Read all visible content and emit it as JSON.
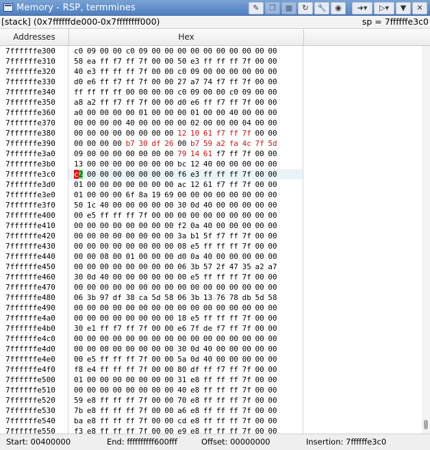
{
  "window": {
    "title": "Memory - RSP, termmines"
  },
  "toolbar": {
    "buttons": [
      "edit-icon",
      "copy-icon",
      "paste-icon",
      "refresh-icon",
      "wrench-icon",
      "camera-icon",
      "goto-icon",
      "run-icon",
      "menu-icon",
      "close-icon"
    ]
  },
  "info": {
    "region": "[stack] (0x7ffffffde000-0x7ffffffff000)",
    "sp": "sp = 7ffffffe3c0"
  },
  "columns": {
    "addresses": "Addresses",
    "hex": "Hex"
  },
  "rows": [
    {
      "addr": "7ffffffe300",
      "bytes": [
        "c0",
        "09",
        "00",
        "00",
        "c0",
        "09",
        "00",
        "00",
        "00",
        "00",
        "00",
        "00",
        "00",
        "00",
        "00",
        "00"
      ]
    },
    {
      "addr": "7ffffffe310",
      "bytes": [
        "58",
        "ea",
        "ff",
        "f7",
        "ff",
        "7f",
        "00",
        "00",
        "50",
        "e3",
        "ff",
        "ff",
        "ff",
        "7f",
        "00",
        "00"
      ]
    },
    {
      "addr": "7ffffffe320",
      "bytes": [
        "40",
        "e3",
        "ff",
        "ff",
        "ff",
        "7f",
        "00",
        "00",
        "c0",
        "09",
        "00",
        "00",
        "00",
        "00",
        "00",
        "00"
      ]
    },
    {
      "addr": "7ffffffe330",
      "bytes": [
        "d0",
        "e6",
        "ff",
        "f7",
        "ff",
        "7f",
        "00",
        "00",
        "27",
        "a7",
        "74",
        "f7",
        "ff",
        "7f",
        "00",
        "00"
      ]
    },
    {
      "addr": "7ffffffe340",
      "bytes": [
        "ff",
        "ff",
        "ff",
        "ff",
        "00",
        "00",
        "00",
        "00",
        "c0",
        "09",
        "00",
        "00",
        "c0",
        "09",
        "00",
        "00"
      ]
    },
    {
      "addr": "7ffffffe350",
      "bytes": [
        "a8",
        "a2",
        "ff",
        "f7",
        "ff",
        "7f",
        "00",
        "00",
        "d0",
        "e6",
        "ff",
        "f7",
        "ff",
        "7f",
        "00",
        "00"
      ]
    },
    {
      "addr": "7ffffffe360",
      "bytes": [
        "a0",
        "00",
        "00",
        "00",
        "00",
        "01",
        "00",
        "00",
        "00",
        "01",
        "00",
        "00",
        "40",
        "00",
        "00",
        "00"
      ]
    },
    {
      "addr": "7ffffffe370",
      "bytes": [
        "00",
        "00",
        "00",
        "00",
        "40",
        "00",
        "00",
        "00",
        "00",
        "02",
        "00",
        "00",
        "00",
        "04",
        "00",
        "00"
      ]
    },
    {
      "addr": "7ffffffe380",
      "bytes": [
        "00",
        "00",
        "00",
        "00",
        "00",
        "00",
        "00",
        "00",
        "12",
        "10",
        "61",
        "f7",
        "ff",
        "7f",
        "00",
        "00"
      ]
    },
    {
      "addr": "7ffffffe390",
      "bytes": [
        "00",
        "00",
        "00",
        "00",
        "b7",
        "30",
        "df",
        "26",
        "00",
        "b7",
        "59",
        "a2",
        "fa",
        "4c",
        "7f",
        "5d"
      ]
    },
    {
      "addr": "7ffffffe3a0",
      "bytes": [
        "09",
        "00",
        "00",
        "00",
        "00",
        "00",
        "00",
        "00",
        "79",
        "14",
        "61",
        "f7",
        "ff",
        "7f",
        "00",
        "00"
      ]
    },
    {
      "addr": "7ffffffe3b0",
      "bytes": [
        "13",
        "00",
        "00",
        "00",
        "00",
        "00",
        "00",
        "00",
        "bc",
        "12",
        "40",
        "00",
        "00",
        "00",
        "00",
        "00"
      ]
    },
    {
      "addr": "7ffffffe3c0",
      "bytes": [
        "c2",
        "00",
        "00",
        "00",
        "00",
        "00",
        "00",
        "00",
        "f6",
        "e3",
        "ff",
        "ff",
        "ff",
        "7f",
        "00",
        "00"
      ]
    },
    {
      "addr": "7ffffffe3d0",
      "bytes": [
        "01",
        "00",
        "00",
        "00",
        "00",
        "00",
        "00",
        "00",
        "ac",
        "12",
        "61",
        "f7",
        "ff",
        "7f",
        "00",
        "00"
      ]
    },
    {
      "addr": "7ffffffe3e0",
      "bytes": [
        "01",
        "00",
        "00",
        "00",
        "6f",
        "8a",
        "19",
        "69",
        "00",
        "00",
        "00",
        "00",
        "00",
        "00",
        "00",
        "00"
      ]
    },
    {
      "addr": "7ffffffe3f0",
      "bytes": [
        "50",
        "1c",
        "40",
        "00",
        "00",
        "00",
        "00",
        "00",
        "30",
        "0d",
        "40",
        "00",
        "00",
        "00",
        "00",
        "00"
      ]
    },
    {
      "addr": "7ffffffe400",
      "bytes": [
        "00",
        "e5",
        "ff",
        "ff",
        "ff",
        "7f",
        "00",
        "00",
        "00",
        "00",
        "00",
        "00",
        "00",
        "00",
        "00",
        "00"
      ]
    },
    {
      "addr": "7ffffffe410",
      "bytes": [
        "00",
        "00",
        "00",
        "00",
        "00",
        "00",
        "00",
        "00",
        "f2",
        "0a",
        "40",
        "00",
        "00",
        "00",
        "00",
        "00"
      ]
    },
    {
      "addr": "7ffffffe420",
      "bytes": [
        "00",
        "00",
        "00",
        "00",
        "00",
        "00",
        "00",
        "00",
        "3a",
        "b1",
        "5f",
        "f7",
        "ff",
        "7f",
        "00",
        "00"
      ]
    },
    {
      "addr": "7ffffffe430",
      "bytes": [
        "00",
        "00",
        "00",
        "00",
        "00",
        "00",
        "00",
        "00",
        "08",
        "e5",
        "ff",
        "ff",
        "ff",
        "7f",
        "00",
        "00"
      ]
    },
    {
      "addr": "7ffffffe440",
      "bytes": [
        "00",
        "00",
        "08",
        "00",
        "01",
        "00",
        "00",
        "00",
        "d0",
        "0a",
        "40",
        "00",
        "00",
        "00",
        "00",
        "00"
      ]
    },
    {
      "addr": "7ffffffe450",
      "bytes": [
        "00",
        "00",
        "00",
        "00",
        "00",
        "00",
        "00",
        "00",
        "06",
        "3b",
        "57",
        "2f",
        "47",
        "35",
        "a2",
        "a7"
      ]
    },
    {
      "addr": "7ffffffe460",
      "bytes": [
        "30",
        "0d",
        "40",
        "00",
        "00",
        "00",
        "00",
        "00",
        "00",
        "e5",
        "ff",
        "ff",
        "ff",
        "7f",
        "00",
        "00"
      ]
    },
    {
      "addr": "7ffffffe470",
      "bytes": [
        "00",
        "00",
        "00",
        "00",
        "00",
        "00",
        "00",
        "00",
        "00",
        "00",
        "00",
        "00",
        "00",
        "00",
        "00",
        "00"
      ]
    },
    {
      "addr": "7ffffffe480",
      "bytes": [
        "06",
        "3b",
        "97",
        "df",
        "38",
        "ca",
        "5d",
        "58",
        "06",
        "3b",
        "13",
        "76",
        "78",
        "db",
        "5d",
        "58"
      ]
    },
    {
      "addr": "7ffffffe490",
      "bytes": [
        "00",
        "00",
        "00",
        "00",
        "00",
        "00",
        "00",
        "00",
        "00",
        "00",
        "00",
        "00",
        "00",
        "00",
        "00",
        "00"
      ]
    },
    {
      "addr": "7ffffffe4a0",
      "bytes": [
        "00",
        "00",
        "00",
        "00",
        "00",
        "00",
        "00",
        "00",
        "18",
        "e5",
        "ff",
        "ff",
        "ff",
        "7f",
        "00",
        "00"
      ]
    },
    {
      "addr": "7ffffffe4b0",
      "bytes": [
        "30",
        "e1",
        "ff",
        "f7",
        "ff",
        "7f",
        "00",
        "00",
        "e6",
        "7f",
        "de",
        "f7",
        "ff",
        "7f",
        "00",
        "00"
      ]
    },
    {
      "addr": "7ffffffe4c0",
      "bytes": [
        "00",
        "00",
        "00",
        "00",
        "00",
        "00",
        "00",
        "00",
        "00",
        "00",
        "00",
        "00",
        "00",
        "00",
        "00",
        "00"
      ]
    },
    {
      "addr": "7ffffffe4d0",
      "bytes": [
        "00",
        "00",
        "00",
        "00",
        "00",
        "00",
        "00",
        "00",
        "30",
        "0d",
        "40",
        "00",
        "00",
        "00",
        "00",
        "00"
      ]
    },
    {
      "addr": "7ffffffe4e0",
      "bytes": [
        "00",
        "e5",
        "ff",
        "ff",
        "ff",
        "7f",
        "00",
        "00",
        "5a",
        "0d",
        "40",
        "00",
        "00",
        "00",
        "00",
        "00"
      ]
    },
    {
      "addr": "7ffffffe4f0",
      "bytes": [
        "f8",
        "e4",
        "ff",
        "ff",
        "ff",
        "7f",
        "00",
        "00",
        "80",
        "df",
        "ff",
        "f7",
        "ff",
        "7f",
        "00",
        "00"
      ]
    },
    {
      "addr": "7ffffffe500",
      "bytes": [
        "01",
        "00",
        "00",
        "00",
        "00",
        "00",
        "00",
        "00",
        "31",
        "e8",
        "ff",
        "ff",
        "ff",
        "7f",
        "00",
        "00"
      ]
    },
    {
      "addr": "7ffffffe510",
      "bytes": [
        "00",
        "00",
        "00",
        "00",
        "00",
        "00",
        "00",
        "00",
        "40",
        "e8",
        "ff",
        "ff",
        "ff",
        "7f",
        "00",
        "00"
      ]
    },
    {
      "addr": "7ffffffe520",
      "bytes": [
        "59",
        "e8",
        "ff",
        "ff",
        "ff",
        "7f",
        "00",
        "00",
        "70",
        "e8",
        "ff",
        "ff",
        "ff",
        "7f",
        "00",
        "00"
      ]
    },
    {
      "addr": "7ffffffe530",
      "bytes": [
        "7b",
        "e8",
        "ff",
        "ff",
        "ff",
        "7f",
        "00",
        "00",
        "a6",
        "e8",
        "ff",
        "ff",
        "ff",
        "7f",
        "00",
        "00"
      ]
    },
    {
      "addr": "7ffffffe540",
      "bytes": [
        "ba",
        "e8",
        "ff",
        "ff",
        "ff",
        "7f",
        "00",
        "00",
        "cd",
        "e8",
        "ff",
        "ff",
        "ff",
        "7f",
        "00",
        "00"
      ]
    },
    {
      "addr": "7ffffffe550",
      "bytes": [
        "f3",
        "e8",
        "ff",
        "ff",
        "ff",
        "7f",
        "00",
        "00",
        "e9",
        "e8",
        "ff",
        "ff",
        "ff",
        "7f",
        "00",
        "00"
      ]
    }
  ],
  "highlights": {
    "red": {
      "7ffffffe380": [
        8,
        9,
        10,
        11,
        12,
        13
      ],
      "7ffffffe390": [
        4,
        5,
        6,
        7,
        9,
        10,
        11,
        12,
        13,
        14,
        15
      ],
      "7ffffffe3a0": [
        8,
        9,
        10
      ]
    },
    "cursor_row": "7ffffffe3c0",
    "cursor_byte": 0,
    "selection_byte": 0,
    "colors": {
      "changed": "#cc1111",
      "cursor": "#e01010",
      "selection": "#5ed25e",
      "row": "#e8f4f8"
    }
  },
  "status": {
    "start": "Start:  00400000",
    "end": "End:  ffffffffff600fff",
    "offset": "Offset:  00000000",
    "insertion": "Insertion:  7ffffffe3c0"
  }
}
